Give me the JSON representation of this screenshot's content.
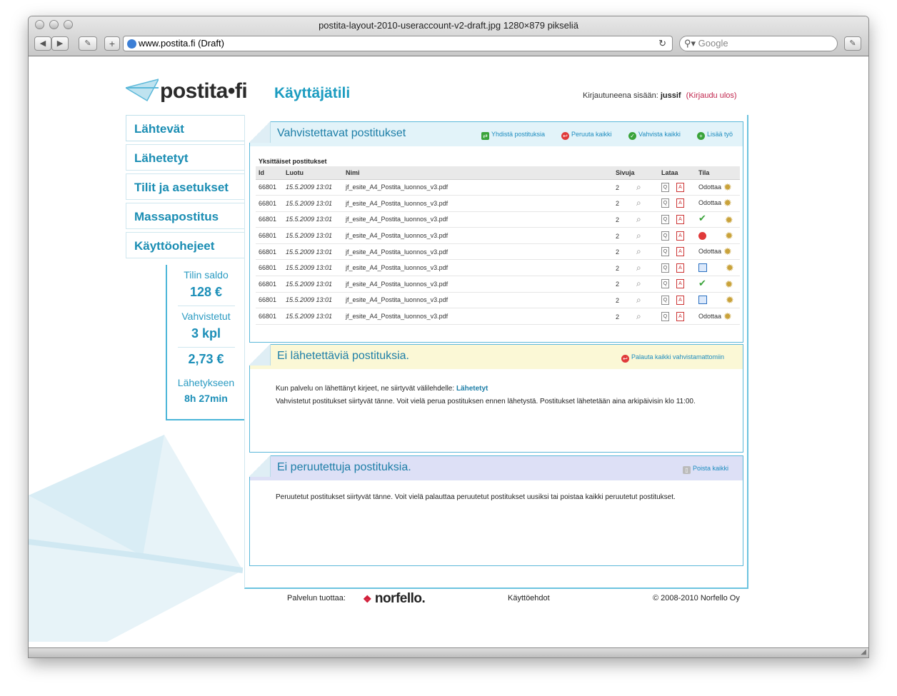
{
  "browser": {
    "window_title": "postita-layout-2010-useraccount-v2-draft.jpg 1280×879 pikseliä",
    "url": "www.postita.fi (Draft)",
    "search_placeholder": "Google"
  },
  "header": {
    "logo": "postita•fi",
    "page_title": "Käyttäjätili",
    "login_label": "Kirjautuneena sisään:",
    "username": "jussif",
    "logout": "(Kirjaudu ulos)"
  },
  "sidebar": {
    "items": [
      "Lähtevät",
      "Lähetetyt",
      "Tilit ja asetukset",
      "Massapostitus",
      "Käyttöohejeet"
    ]
  },
  "balance": {
    "saldo_label": "Tilin saldo",
    "saldo_value": "128 €",
    "confirmed_label": "Vahvistetut",
    "confirmed_count": "3 kpl",
    "confirmed_price": "2,73 €",
    "send_label": "Lähetykseen",
    "send_time": "8h 27min"
  },
  "panel1": {
    "title": "Vahvistettavat postitukset",
    "actions": [
      "Yhdistä postituksia",
      "Peruuta kaikki",
      "Vahvista kaikki",
      "Lisää työ"
    ],
    "subtitle": "Yksittäiset postitukset",
    "columns": [
      "Id",
      "Luotu",
      "Nimi",
      "Sivuja",
      "Lataa",
      "Tila"
    ],
    "rows": [
      {
        "id": "66801",
        "created": "15.5.2009 13:01",
        "name": "jf_esite_A4_Postita_luonnos_v3.pdf",
        "pages": "2",
        "status": "Odottaa"
      },
      {
        "id": "66801",
        "created": "15.5.2009 13:01",
        "name": "jf_esite_A4_Postita_luonnos_v3.pdf",
        "pages": "2",
        "status": "Odottaa"
      },
      {
        "id": "66801",
        "created": "15.5.2009 13:01",
        "name": "jf_esite_A4_Postita_luonnos_v3.pdf",
        "pages": "2",
        "status": "check"
      },
      {
        "id": "66801",
        "created": "15.5.2009 13:01",
        "name": "jf_esite_A4_Postita_luonnos_v3.pdf",
        "pages": "2",
        "status": "cancel"
      },
      {
        "id": "66801",
        "created": "15.5.2009 13:01",
        "name": "jf_esite_A4_Postita_luonnos_v3.pdf",
        "pages": "2",
        "status": "Odottaa"
      },
      {
        "id": "66801",
        "created": "15.5.2009 13:01",
        "name": "jf_esite_A4_Postita_luonnos_v3.pdf",
        "pages": "2",
        "status": "calendar"
      },
      {
        "id": "66801",
        "created": "15.5.2009 13:01",
        "name": "jf_esite_A4_Postita_luonnos_v3.pdf",
        "pages": "2",
        "status": "check"
      },
      {
        "id": "66801",
        "created": "15.5.2009 13:01",
        "name": "jf_esite_A4_Postita_luonnos_v3.pdf",
        "pages": "2",
        "status": "calendar"
      },
      {
        "id": "66801",
        "created": "15.5.2009 13:01",
        "name": "jf_esite_A4_Postita_luonnos_v3.pdf",
        "pages": "2",
        "status": "Odottaa"
      }
    ]
  },
  "panel2": {
    "title": "Ei lähetettäviä postituksia.",
    "action": "Palauta kaikki vahvistamattomiin",
    "text1": "Kun palvelu on lähettänyt kirjeet, ne siirtyvät välilehdelle:",
    "text1_link": "Lähetetyt",
    "text2": "Vahvistetut postitukset siirtyvät tänne. Voit vielä perua postituksen ennen lähetystä. Postitukset lähetetään aina arkipäivisin klo 11:00."
  },
  "panel3": {
    "title": "Ei peruutettuja postituksia.",
    "action": "Poista kaikki",
    "text": "Peruutetut postitukset siirtyvät tänne. Voit vielä palauttaa peruutetut postitukset uusiksi tai poistaa kaikki peruutetut postitukset."
  },
  "footer": {
    "provider_label": "Palvelun tuottaa:",
    "provider_logo": "norfello.",
    "terms": "Käyttöehdot",
    "copyright": "© 2008-2010 Norfello Oy"
  },
  "colors": {
    "accent": "#1c9cc0",
    "panel2_head": "#fbf8d6",
    "panel3_head": "#dde0f6",
    "logout": "#c0244c"
  }
}
